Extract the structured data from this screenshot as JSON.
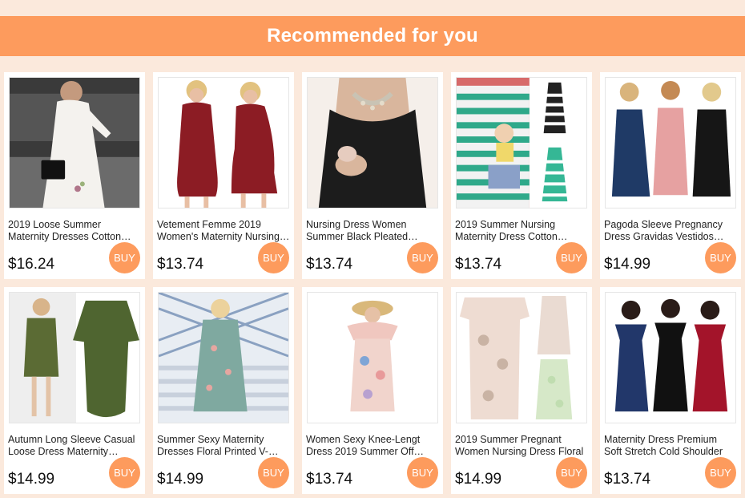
{
  "header": {
    "title": "Recommended for you"
  },
  "buy_label": "BUY",
  "products": [
    {
      "title": "2019 Loose Summer Maternity Dresses Cotton Linen",
      "price": "$16.24",
      "image_icon": "white-dress-photo"
    },
    {
      "title": "Vetement Femme 2019 Women's Maternity Nursing Dress",
      "price": "$13.74",
      "image_icon": "burgundy-dress-photo"
    },
    {
      "title": "Nursing Dress Women Summer Black Pleated Maternity",
      "price": "$13.74",
      "image_icon": "black-dress-photo"
    },
    {
      "title": "2019 Summer Nursing Maternity Dress Cotton Striped",
      "price": "$13.74",
      "image_icon": "striped-dress-photo"
    },
    {
      "title": "Pagoda Sleeve Pregnancy Dress Gravidas Vestidos Summer",
      "price": "$14.99",
      "image_icon": "three-models-photo"
    },
    {
      "title": "Autumn Long Sleeve Casual Loose Dress Maternity Pocket",
      "price": "$14.99",
      "image_icon": "olive-dress-photo"
    },
    {
      "title": "Summer Sexy Maternity Dresses Floral Printed V-Neck",
      "price": "$14.99",
      "image_icon": "floral-blue-dress-photo"
    },
    {
      "title": "Women Sexy Knee-Lengt Dress 2019 Summer Off Shoulder",
      "price": "$13.74",
      "image_icon": "pink-floral-dress-photo"
    },
    {
      "title": "2019 Summer Pregnant Women Nursing Dress Floral",
      "price": "$14.99",
      "image_icon": "floral-wrap-dress-photo"
    },
    {
      "title": "Maternity Dress Premium Soft Stretch Cold Shoulder",
      "price": "$13.74",
      "image_icon": "off-shoulder-dresses-photo"
    }
  ],
  "colors": {
    "accent": "#fd9b5d",
    "background": "#fbe9dc"
  }
}
